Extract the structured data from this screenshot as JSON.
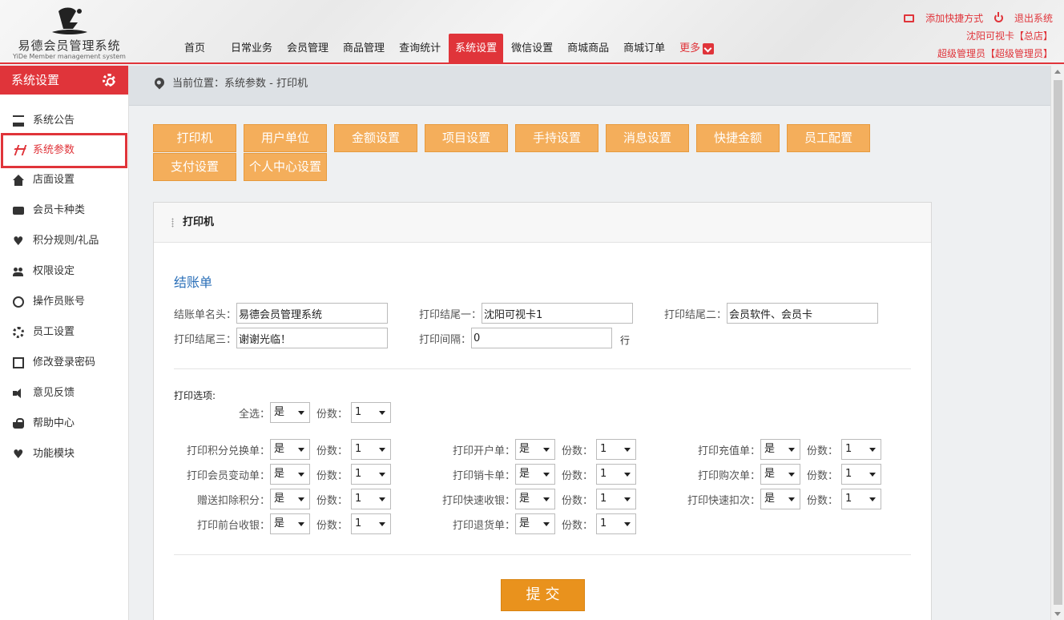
{
  "header": {
    "app_title": "易德会员管理系统",
    "app_subtitle": "YiDe Member management system",
    "nav": [
      "首页",
      "日常业务",
      "会员管理",
      "商品管理",
      "查询统计",
      "系统设置",
      "微信设置",
      "商城商品",
      "商城订单"
    ],
    "nav_more": "更多",
    "add_shortcut": "添加快捷方式",
    "logout": "退出系统",
    "store": "沈阳可视卡【总店】",
    "user": "超级管理员【超级管理员】"
  },
  "sidebar": {
    "title": "系统设置",
    "items": [
      {
        "label": "系统公告",
        "icon": "calendar-icon"
      },
      {
        "label": "系统参数",
        "icon": "params-icon"
      },
      {
        "label": "店面设置",
        "icon": "home-icon"
      },
      {
        "label": "会员卡种类",
        "icon": "card-icon"
      },
      {
        "label": "积分规则/礼品",
        "icon": "heart-icon"
      },
      {
        "label": "权限设定",
        "icon": "users-icon"
      },
      {
        "label": "操作员账号",
        "icon": "user-circle-icon"
      },
      {
        "label": "员工设置",
        "icon": "gear-icon"
      },
      {
        "label": "修改登录密码",
        "icon": "edit-icon"
      },
      {
        "label": "意见反馈",
        "icon": "speaker-icon"
      },
      {
        "label": "帮助中心",
        "icon": "basket-icon"
      },
      {
        "label": "功能模块",
        "icon": "heart-icon"
      }
    ]
  },
  "breadcrumb": "当前位置：系统参数 - 打印机",
  "tabs": [
    "打印机",
    "用户单位",
    "金额设置",
    "项目设置",
    "手持设置",
    "消息设置",
    "快捷金额",
    "员工配置",
    "支付设置",
    "个人中心设置"
  ],
  "panel": {
    "title": "打印机",
    "section": "结账单",
    "fields": {
      "receipt_head": {
        "label": "结账单名头：",
        "value": "易德会员管理系统"
      },
      "tail1": {
        "label": "打印结尾一：",
        "value": "沈阳可视卡1"
      },
      "tail2": {
        "label": "打印结尾二：",
        "value": "会员软件、会员卡"
      },
      "tail3": {
        "label": "打印结尾三：",
        "value": "谢谢光临！"
      },
      "interval": {
        "label": "打印间隔：",
        "value": "0",
        "unit": "行"
      }
    },
    "options_title": "打印选项:",
    "count_label": "份数：",
    "select_all": {
      "label": "全选：",
      "value": "是",
      "count": "1"
    },
    "options": [
      {
        "label": "打印积分兑换单：",
        "value": "是",
        "count": "1"
      },
      {
        "label": "打印开户单：",
        "value": "是",
        "count": "1"
      },
      {
        "label": "打印充值单：",
        "value": "是",
        "count": "1"
      },
      {
        "label": "打印会员变动单：",
        "value": "是",
        "count": "1"
      },
      {
        "label": "打印销卡单：",
        "value": "是",
        "count": "1"
      },
      {
        "label": "打印购次单：",
        "value": "是",
        "count": "1"
      },
      {
        "label": "赠送扣除积分：",
        "value": "是",
        "count": "1"
      },
      {
        "label": "打印快速收银：",
        "value": "是",
        "count": "1"
      },
      {
        "label": "打印快速扣次：",
        "value": "是",
        "count": "1"
      },
      {
        "label": "打印前台收银：",
        "value": "是",
        "count": "1"
      },
      {
        "label": "打印退货单：",
        "value": "是",
        "count": "1"
      }
    ],
    "submit": "提交"
  },
  "colors": {
    "accent": "#e0343a",
    "tab": "#f4ae5b",
    "submit": "#e9921d",
    "section": "#2a6fb8"
  }
}
